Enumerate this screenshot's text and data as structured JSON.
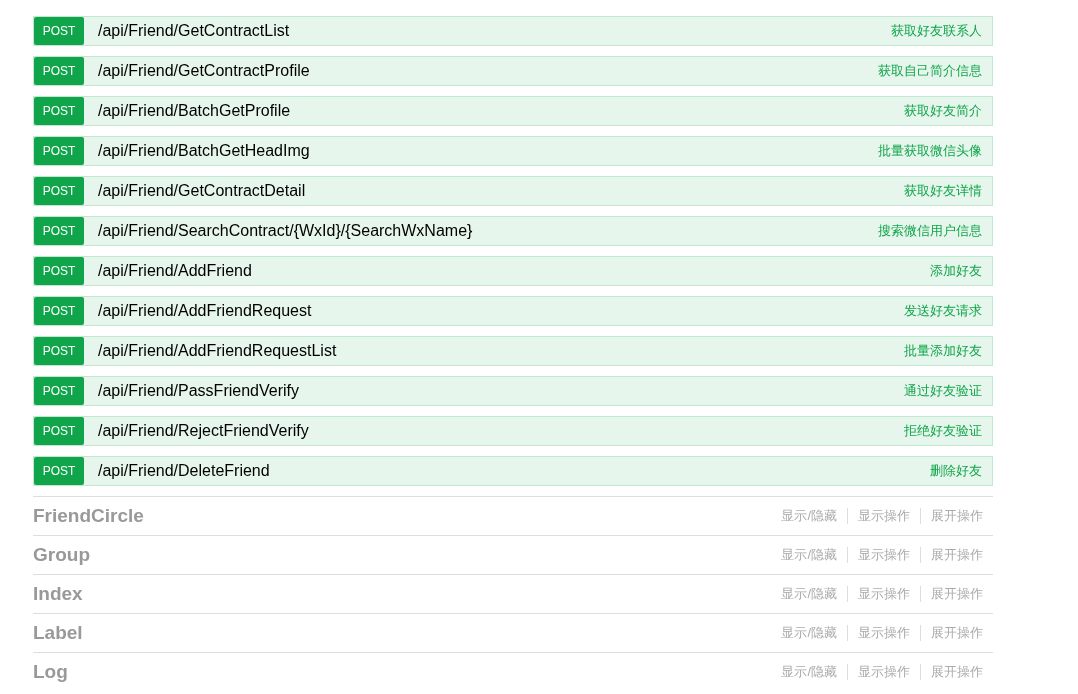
{
  "endpoints": [
    {
      "method": "POST",
      "path": "/api/Friend/GetContractList",
      "summary": "获取好友联系人"
    },
    {
      "method": "POST",
      "path": "/api/Friend/GetContractProfile",
      "summary": "获取自己简介信息"
    },
    {
      "method": "POST",
      "path": "/api/Friend/BatchGetProfile",
      "summary": "获取好友简介"
    },
    {
      "method": "POST",
      "path": "/api/Friend/BatchGetHeadImg",
      "summary": "批量获取微信头像"
    },
    {
      "method": "POST",
      "path": "/api/Friend/GetContractDetail",
      "summary": "获取好友详情"
    },
    {
      "method": "POST",
      "path": "/api/Friend/SearchContract/{WxId}/{SearchWxName}",
      "summary": "搜索微信用户信息"
    },
    {
      "method": "POST",
      "path": "/api/Friend/AddFriend",
      "summary": "添加好友"
    },
    {
      "method": "POST",
      "path": "/api/Friend/AddFriendRequest",
      "summary": "发送好友请求"
    },
    {
      "method": "POST",
      "path": "/api/Friend/AddFriendRequestList",
      "summary": "批量添加好友"
    },
    {
      "method": "POST",
      "path": "/api/Friend/PassFriendVerify",
      "summary": "通过好友验证"
    },
    {
      "method": "POST",
      "path": "/api/Friend/RejectFriendVerify",
      "summary": "拒绝好友验证"
    },
    {
      "method": "POST",
      "path": "/api/Friend/DeleteFriend",
      "summary": "删除好友"
    }
  ],
  "sections": [
    {
      "name": "FriendCircle",
      "actions": [
        "显示/隐藏",
        "显示操作",
        "展开操作"
      ]
    },
    {
      "name": "Group",
      "actions": [
        "显示/隐藏",
        "显示操作",
        "展开操作"
      ]
    },
    {
      "name": "Index",
      "actions": [
        "显示/隐藏",
        "显示操作",
        "展开操作"
      ]
    },
    {
      "name": "Label",
      "actions": [
        "显示/隐藏",
        "显示操作",
        "展开操作"
      ]
    },
    {
      "name": "Log",
      "actions": [
        "显示/隐藏",
        "显示操作",
        "展开操作"
      ]
    }
  ]
}
